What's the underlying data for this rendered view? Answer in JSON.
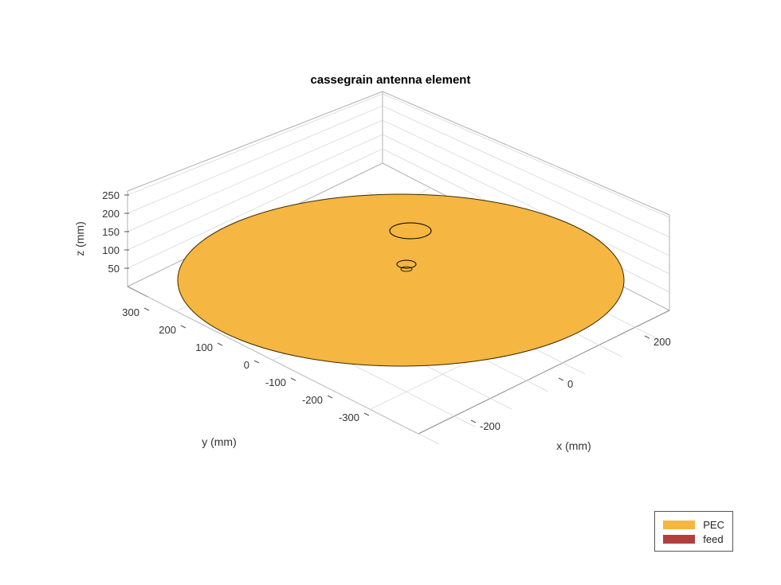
{
  "chart_data": {
    "type": "3d-surface",
    "title": "cassegrain antenna element",
    "xlabel": "x (mm)",
    "ylabel": "y (mm)",
    "zlabel": "z (mm)",
    "x_ticks": [
      -200,
      0,
      200
    ],
    "y_ticks": [
      -300,
      -200,
      -100,
      0,
      100,
      200,
      300
    ],
    "z_ticks": [
      50,
      100,
      150,
      200,
      250
    ],
    "xlim": [
      -300,
      300
    ],
    "ylim": [
      -350,
      350
    ],
    "zlim": [
      0,
      260
    ],
    "legend": [
      {
        "label": "PEC",
        "color": "#f5b642"
      },
      {
        "label": "feed",
        "color": "#b33e3e"
      }
    ],
    "geometry": {
      "main_reflector_radius_mm": 300,
      "sub_reflector_radius_mm": 30,
      "feed_radius_mm": 12,
      "main_reflector_color": "#f5b642",
      "feed_color": "#b33e3e"
    }
  }
}
